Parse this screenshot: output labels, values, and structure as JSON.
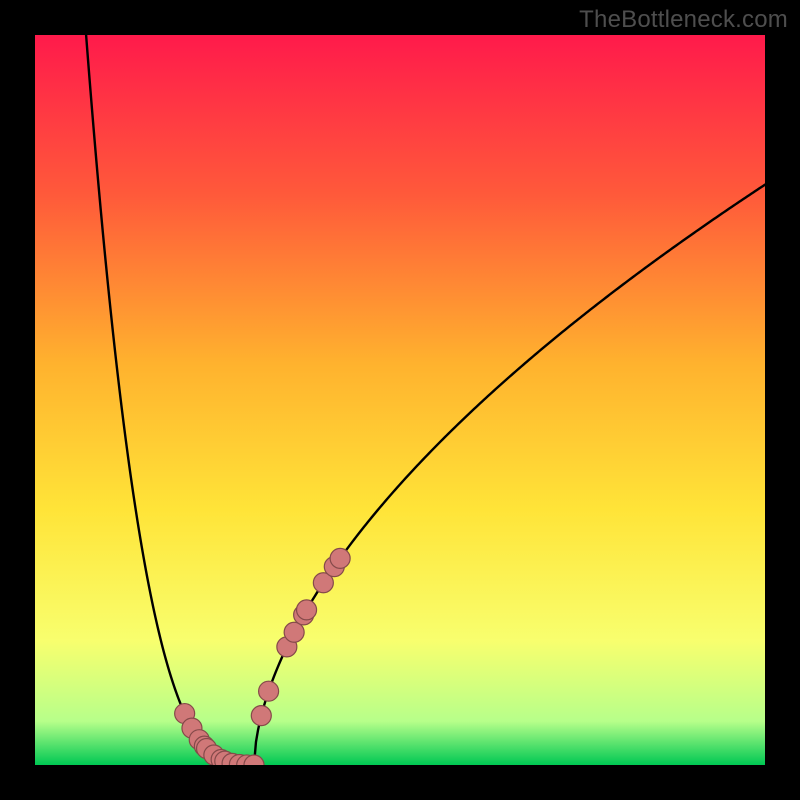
{
  "watermark": "TheBottleneck.com",
  "colors": {
    "frame": "#000000",
    "gradient_stops": [
      "#ff1a4b",
      "#ff5a3a",
      "#ffb22e",
      "#ffe438",
      "#f8ff6e",
      "#b7ff8a",
      "#00c853"
    ],
    "curve": "#000000",
    "marker_fill": "#d07878",
    "marker_stroke": "#854a4a"
  },
  "chart_data": {
    "type": "line",
    "title": "",
    "xlabel": "",
    "ylabel": "",
    "xlim": [
      0,
      1
    ],
    "ylim": [
      0,
      1
    ],
    "curve": {
      "x_break": 0.3,
      "left": {
        "x_start": 0.07,
        "exponent": 3.0
      },
      "right": {
        "x_end": 1.0,
        "y_end": 0.795,
        "exponent": 0.58
      }
    },
    "markers": {
      "left_cluster_x": [
        0.205,
        0.215,
        0.225,
        0.232,
        0.235,
        0.245,
        0.255,
        0.26,
        0.27
      ],
      "right_cluster_x": [
        0.345,
        0.355,
        0.368,
        0.372,
        0.395,
        0.41,
        0.418
      ],
      "bottom_cluster_x": [
        0.28,
        0.29,
        0.3,
        0.31,
        0.32
      ],
      "radius_px": 10
    }
  }
}
